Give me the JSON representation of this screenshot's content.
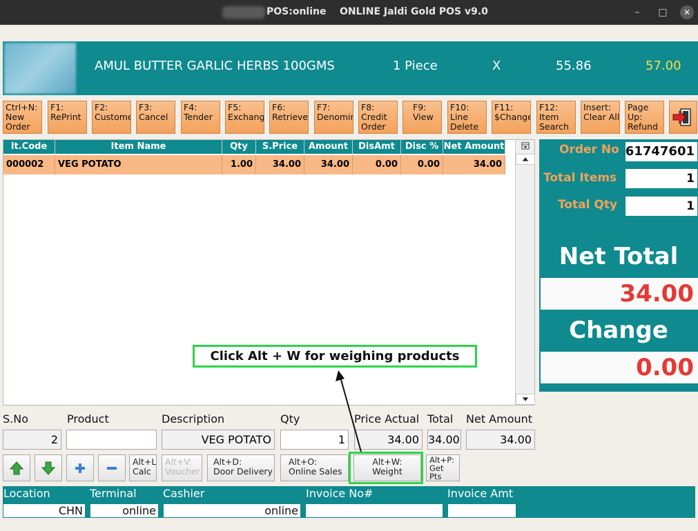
{
  "window": {
    "title": "POS:online    ONLINE Jaldi Gold POS v9.0",
    "minimize": "–",
    "maximize": "□",
    "close": "✕"
  },
  "header": {
    "item_name": "AMUL BUTTER GARLIC HERBS 100GMS",
    "unit": "1 Piece",
    "multiplier": "X",
    "price": "55.86",
    "mrp": "57.00",
    "colors": {
      "bg": "#0f8a8f",
      "mrp": "#f5e04a"
    }
  },
  "function_keys": [
    "Ctrl+N:\nNew\nOrder",
    "F1:\nRePrint",
    "F2:\nCustome",
    "F3:\nCancel",
    "F4:\nTender",
    "F5:\nExchang",
    "F6:\nRetrieve",
    "F7:\nDenomin",
    "F8:\nCredit\nOrder",
    "F9:\nView",
    "F10:\nLine\nDelete",
    "F11:\n$Change",
    "F12:\nItem\nSearch",
    "Insert:\nClear All",
    "Page\nUp:\nRefund"
  ],
  "grid": {
    "columns": [
      "It.Code",
      "Item Name",
      "Qty",
      "S.Price",
      "Amount",
      "DisAmt",
      "Disc %",
      "Net Amount"
    ],
    "rows": [
      [
        "000002",
        "VEG POTATO",
        "1.00",
        "34.00",
        "34.00",
        "0.00",
        "0.00",
        "34.00"
      ]
    ]
  },
  "summary": {
    "order_no_label": "Order No",
    "order_no": "61747601",
    "total_items_label": "Total Items",
    "total_items": "1",
    "total_qty_label": "Total Qty",
    "total_qty": "1",
    "net_total_label": "Net Total",
    "net_total": "34.00",
    "change_label": "Change",
    "change": "0.00"
  },
  "entry": {
    "labels": {
      "sno": "S.No",
      "product": "Product",
      "description": "Description",
      "qty": "Qty",
      "price_actual": "Price Actual",
      "total": "Total",
      "net_amount": "Net Amount"
    },
    "sno": "2",
    "product": "",
    "description": "VEG POTATO",
    "qty": "1",
    "price_actual": "34.00",
    "total": "34.00",
    "net_amount": "34.00"
  },
  "actions": {
    "calc": "Alt+L:\nCalc",
    "voucher": "Alt+V:\nVoucher",
    "door_delivery": "Alt+D:\nDoor Delivery",
    "online_sales": "Alt+O:\nOnline Sales",
    "weight": "Alt+W:\nWeight",
    "get_pts": "Alt+P:\nGet\nPts"
  },
  "footer": {
    "location_label": "Location",
    "location": "CHN",
    "terminal_label": "Terminal",
    "terminal": "online",
    "cashier_label": "Cashier",
    "cashier": "online",
    "invoice_no_label": "Invoice No#",
    "invoice_no": "",
    "invoice_amt_label": "Invoice Amt",
    "invoice_amt": ""
  },
  "annotation": {
    "text": "Click Alt + W for weighing products"
  }
}
